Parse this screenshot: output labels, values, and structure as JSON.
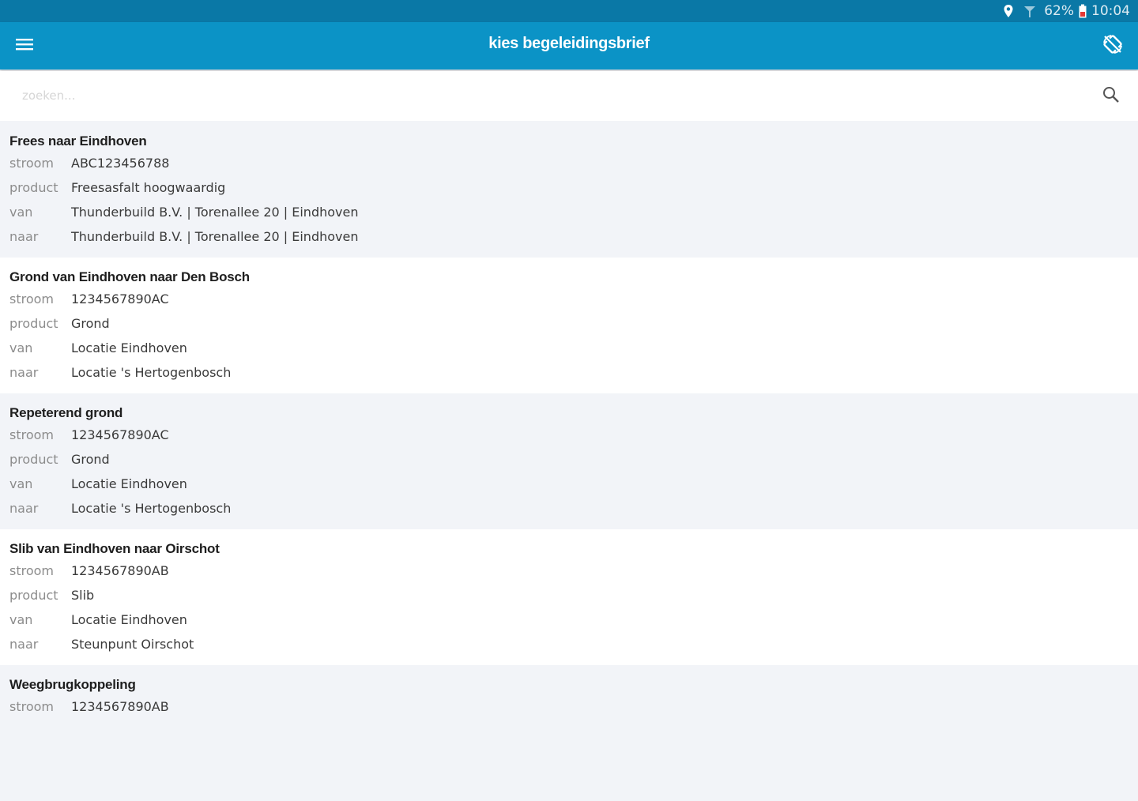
{
  "statusbar": {
    "battery": "62%",
    "time": "10:04",
    "icons": [
      "location-icon",
      "signal-icon",
      "battery-icon"
    ]
  },
  "appbar": {
    "title": "kies begeleidingsbrief",
    "menu_icon": "hamburger-menu-icon",
    "rotation_icon": "screen-rotation-lock-icon"
  },
  "search": {
    "placeholder": "zoeken...",
    "value": "",
    "icon": "search-icon"
  },
  "labels": {
    "stroom": "stroom",
    "product": "product",
    "van": "van",
    "naar": "naar"
  },
  "items": [
    {
      "title": "Frees naar Eindhoven",
      "stroom": "ABC123456788",
      "product": "Freesasfalt hoogwaardig",
      "van": "Thunderbuild B.V. | Torenallee 20 | Eindhoven",
      "naar": "Thunderbuild B.V. | Torenallee 20 | Eindhoven"
    },
    {
      "title": "Grond van Eindhoven naar Den Bosch",
      "stroom": "1234567890AC",
      "product": "Grond",
      "van": "Locatie Eindhoven",
      "naar": "Locatie 's Hertogenbosch"
    },
    {
      "title": "Repeterend grond",
      "stroom": "1234567890AC",
      "product": "Grond",
      "van": "Locatie Eindhoven",
      "naar": "Locatie 's Hertogenbosch"
    },
    {
      "title": "Slib van Eindhoven naar Oirschot",
      "stroom": "1234567890AB",
      "product": "Slib",
      "van": "Locatie Eindhoven",
      "naar": "Steunpunt Oirschot"
    },
    {
      "title": "Weegbrugkoppeling",
      "stroom": "1234567890AB"
    }
  ],
  "colors": {
    "statusbar": "#0a78a6",
    "appbar": "#0b93c6",
    "row_alt": "#f2f4f8",
    "row_plain": "#ffffff"
  }
}
